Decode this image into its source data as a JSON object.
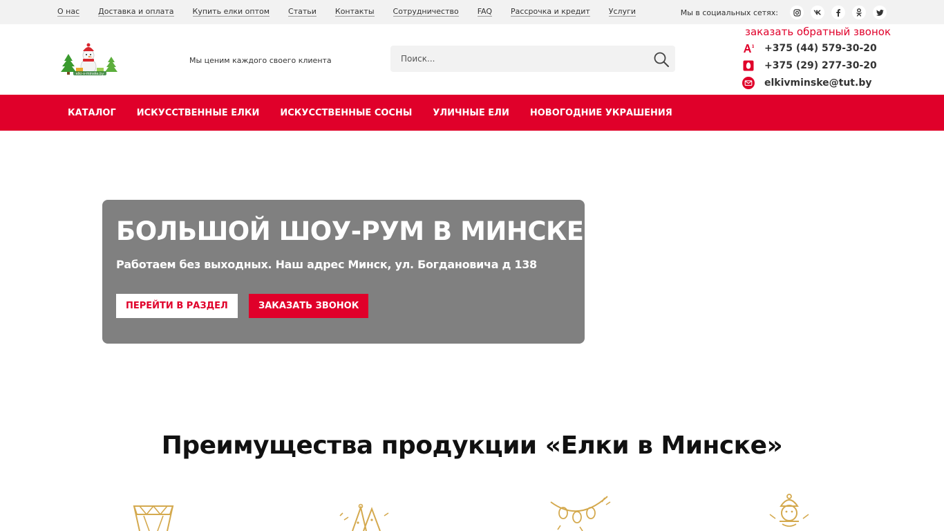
{
  "topbar": {
    "links": [
      "О нас",
      "Доставка и оплата",
      "Купить елки оптом",
      "Статьи",
      "Контакты",
      "Сотрудничество",
      "FAQ",
      "Рассрочка и кредит",
      "Услуги"
    ],
    "social_label": "Мы в социальных сетях:",
    "social_icons": [
      "instagram-icon",
      "vk-icon",
      "facebook-icon",
      "odnoklassniki-icon",
      "twitter-icon"
    ]
  },
  "header": {
    "tagline": "Мы ценим каждого своего клиента",
    "search_placeholder": "Поиск...",
    "callback_label": "заказать обратный звонок",
    "phone_a1": "+375 (44) 579-30-20",
    "phone_mts": "+375 (29) 277-30-20",
    "email": "elkivminske@tut.by"
  },
  "nav": {
    "items": [
      "КАТАЛОГ",
      "ИСКУССТВЕННЫЕ ЕЛКИ",
      "ИСКУССТВЕННЫЕ СОСНЫ",
      "УЛИЧНЫЕ ЕЛИ",
      "НОВОГОДНИЕ УКРАШЕНИЯ"
    ]
  },
  "banner": {
    "title": "БОЛЬШОЙ ШОУ-РУМ В МИНСКЕ",
    "subtitle": "Работаем без выходных. Наш адрес Минск, ул. Богдановича д 138",
    "btn_section": "ПЕРЕЙТИ В РАЗДЕЛ",
    "btn_call": "ЗАКАЗАТЬ ЗВОНОК"
  },
  "advantages": {
    "title": "Преимущества продукции «Елки в Минске»",
    "icons": [
      "medal-icon",
      "party-icon",
      "garland-icon",
      "snowman-icon"
    ]
  },
  "colors": {
    "accent": "#e0002a",
    "banner_bg": "#808080",
    "topbar_bg": "#f2f2f2",
    "icon_gold": "#d4a94e"
  }
}
